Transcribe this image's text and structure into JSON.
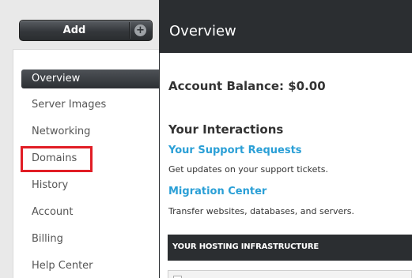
{
  "add_button": {
    "label": "Add",
    "icon": "plus-icon"
  },
  "nav": {
    "items": [
      {
        "label": "Overview",
        "active": true
      },
      {
        "label": "Server Images"
      },
      {
        "label": "Networking"
      },
      {
        "label": "Domains",
        "highlighted": true
      },
      {
        "label": "History"
      },
      {
        "label": "Account"
      },
      {
        "label": "Billing"
      },
      {
        "label": "Help Center"
      }
    ]
  },
  "header": {
    "title": "Overview"
  },
  "main": {
    "balance": "Account Balance: $0.00",
    "interactions_title": "Your Interactions",
    "links": [
      {
        "title": "Your Support Requests",
        "desc": "Get updates on your support tickets."
      },
      {
        "title": "Migration Center",
        "desc": "Transfer websites, databases, and servers."
      }
    ],
    "infra_title": "YOUR HOSTING INFRASTRUCTURE"
  },
  "colors": {
    "accent_link": "#2a9fd6",
    "highlight_border": "#e11d25",
    "dark_header": "#2b2e31"
  }
}
